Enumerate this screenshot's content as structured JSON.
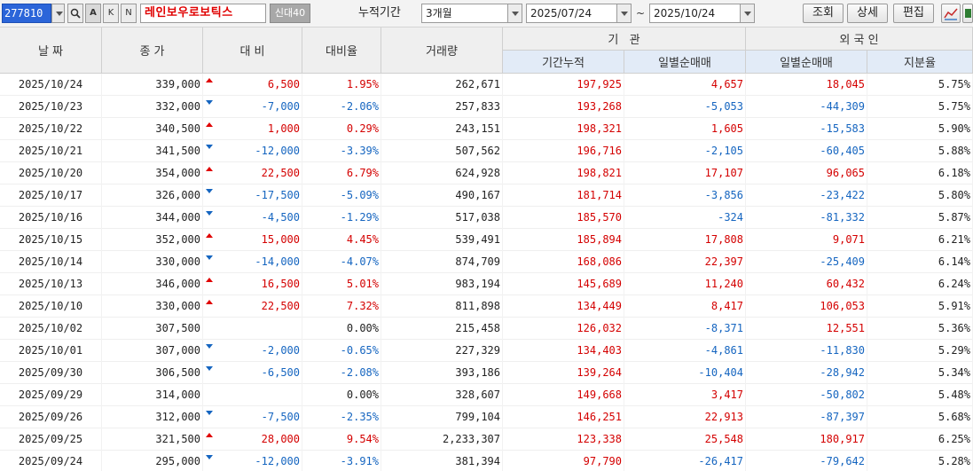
{
  "toolbar": {
    "code": "277810",
    "btn_search": "🔍",
    "btn_a": "A",
    "btn_k": "K",
    "btn_n": "N",
    "stock_name": "레인보우로보틱스",
    "tag": "신대40",
    "period_label": "누적기간",
    "period_value": "3개월",
    "start_date": "2025/07/24",
    "tilde": "~",
    "end_date": "2025/10/24",
    "btn_query": "조회",
    "btn_detail": "상세",
    "btn_edit": "편집"
  },
  "headers": {
    "date": "날 짜",
    "close": "종 가",
    "diff": "대 비",
    "rate": "대비율",
    "volume": "거래량",
    "institution": "기   관",
    "inst_cum": "기간누적",
    "inst_daily": "일별순매매",
    "foreign": "외 국 인",
    "foreign_daily": "일별순매매",
    "foreign_share": "지분율"
  },
  "colors": {
    "up": "#d40000",
    "down": "#1565c0",
    "code_bg": "#2b65d9"
  },
  "rows": [
    {
      "date": "2025/10/24",
      "close": "339,000",
      "dir": "up",
      "diff": "6,500",
      "rate": "1.95%",
      "volume": "262,671",
      "cum": "197,925",
      "inst": "4,657",
      "fnet": "18,045",
      "share": "5.75%"
    },
    {
      "date": "2025/10/23",
      "close": "332,000",
      "dir": "down",
      "diff": "-7,000",
      "rate": "-2.06%",
      "volume": "257,833",
      "cum": "193,268",
      "inst": "-5,053",
      "fnet": "-44,309",
      "share": "5.75%"
    },
    {
      "date": "2025/10/22",
      "close": "340,500",
      "dir": "up",
      "diff": "1,000",
      "rate": "0.29%",
      "volume": "243,151",
      "cum": "198,321",
      "inst": "1,605",
      "fnet": "-15,583",
      "share": "5.90%"
    },
    {
      "date": "2025/10/21",
      "close": "341,500",
      "dir": "down",
      "diff": "-12,000",
      "rate": "-3.39%",
      "volume": "507,562",
      "cum": "196,716",
      "inst": "-2,105",
      "fnet": "-60,405",
      "share": "5.88%"
    },
    {
      "date": "2025/10/20",
      "close": "354,000",
      "dir": "up",
      "diff": "22,500",
      "rate": "6.79%",
      "volume": "624,928",
      "cum": "198,821",
      "inst": "17,107",
      "fnet": "96,065",
      "share": "6.18%"
    },
    {
      "date": "2025/10/17",
      "close": "326,000",
      "dir": "down",
      "diff": "-17,500",
      "rate": "-5.09%",
      "volume": "490,167",
      "cum": "181,714",
      "inst": "-3,856",
      "fnet": "-23,422",
      "share": "5.80%"
    },
    {
      "date": "2025/10/16",
      "close": "344,000",
      "dir": "down",
      "diff": "-4,500",
      "rate": "-1.29%",
      "volume": "517,038",
      "cum": "185,570",
      "inst": "-324",
      "fnet": "-81,332",
      "share": "5.87%"
    },
    {
      "date": "2025/10/15",
      "close": "352,000",
      "dir": "up",
      "diff": "15,000",
      "rate": "4.45%",
      "volume": "539,491",
      "cum": "185,894",
      "inst": "17,808",
      "fnet": "9,071",
      "share": "6.21%"
    },
    {
      "date": "2025/10/14",
      "close": "330,000",
      "dir": "down",
      "diff": "-14,000",
      "rate": "-4.07%",
      "volume": "874,709",
      "cum": "168,086",
      "inst": "22,397",
      "fnet": "-25,409",
      "share": "6.14%"
    },
    {
      "date": "2025/10/13",
      "close": "346,000",
      "dir": "up",
      "diff": "16,500",
      "rate": "5.01%",
      "volume": "983,194",
      "cum": "145,689",
      "inst": "11,240",
      "fnet": "60,432",
      "share": "6.24%"
    },
    {
      "date": "2025/10/10",
      "close": "330,000",
      "dir": "up",
      "diff": "22,500",
      "rate": "7.32%",
      "volume": "811,898",
      "cum": "134,449",
      "inst": "8,417",
      "fnet": "106,053",
      "share": "5.91%"
    },
    {
      "date": "2025/10/02",
      "close": "307,500",
      "dir": "flat",
      "diff": "",
      "rate": "0.00%",
      "volume": "215,458",
      "cum": "126,032",
      "inst": "-8,371",
      "fnet": "12,551",
      "share": "5.36%"
    },
    {
      "date": "2025/10/01",
      "close": "307,000",
      "dir": "down",
      "diff": "-2,000",
      "rate": "-0.65%",
      "volume": "227,329",
      "cum": "134,403",
      "inst": "-4,861",
      "fnet": "-11,830",
      "share": "5.29%"
    },
    {
      "date": "2025/09/30",
      "close": "306,500",
      "dir": "down",
      "diff": "-6,500",
      "rate": "-2.08%",
      "volume": "393,186",
      "cum": "139,264",
      "inst": "-10,404",
      "fnet": "-28,942",
      "share": "5.34%"
    },
    {
      "date": "2025/09/29",
      "close": "314,000",
      "dir": "flat",
      "diff": "",
      "rate": "0.00%",
      "volume": "328,607",
      "cum": "149,668",
      "inst": "3,417",
      "fnet": "-50,802",
      "share": "5.48%"
    },
    {
      "date": "2025/09/26",
      "close": "312,000",
      "dir": "down",
      "diff": "-7,500",
      "rate": "-2.35%",
      "volume": "799,104",
      "cum": "146,251",
      "inst": "22,913",
      "fnet": "-87,397",
      "share": "5.68%"
    },
    {
      "date": "2025/09/25",
      "close": "321,500",
      "dir": "up",
      "diff": "28,000",
      "rate": "9.54%",
      "volume": "2,233,307",
      "cum": "123,338",
      "inst": "25,548",
      "fnet": "180,917",
      "share": "6.25%"
    },
    {
      "date": "2025/09/24",
      "close": "295,000",
      "dir": "down",
      "diff": "-12,000",
      "rate": "-3.91%",
      "volume": "381,394",
      "cum": "97,790",
      "inst": "-26,417",
      "fnet": "-79,642",
      "share": "5.28%"
    }
  ]
}
